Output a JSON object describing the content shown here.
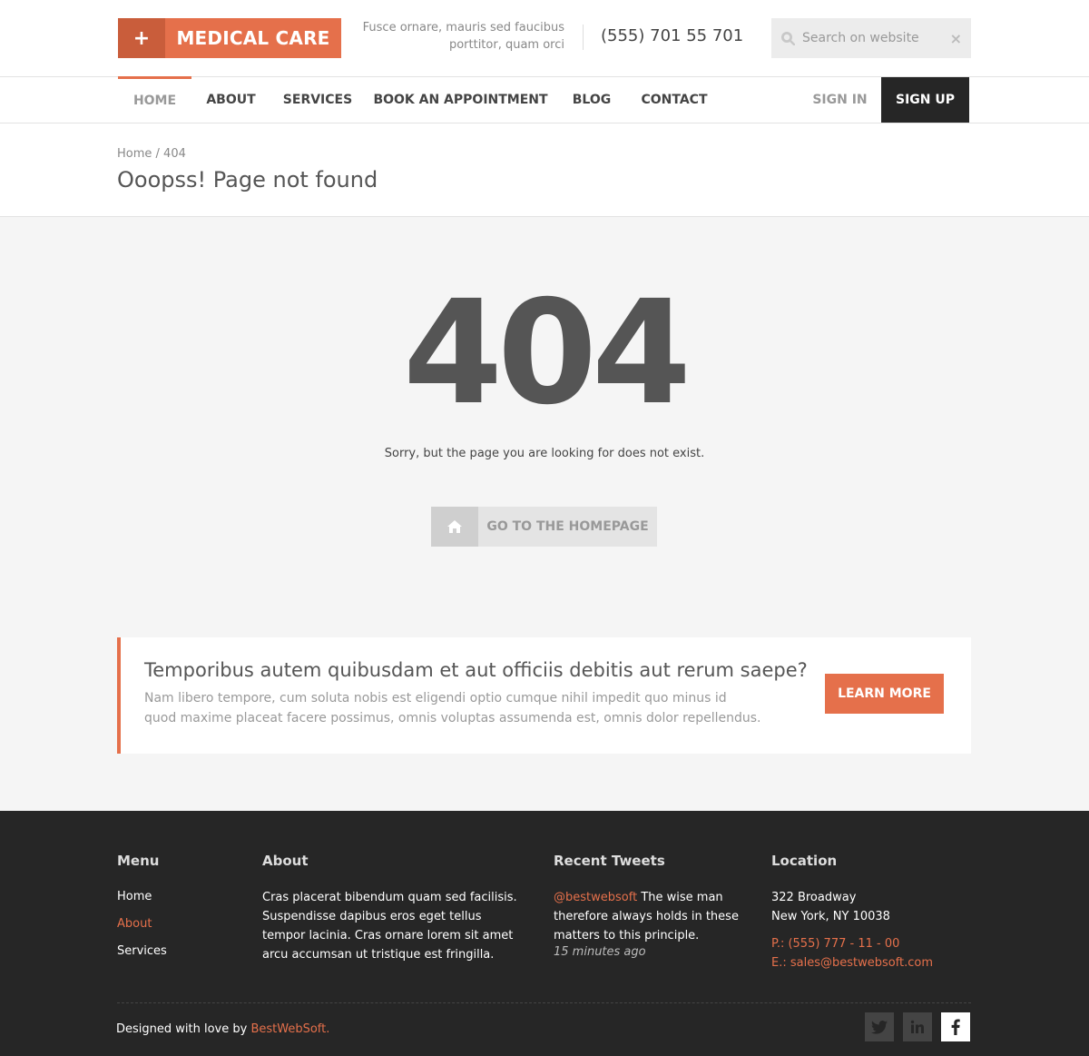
{
  "header": {
    "logo_plus": "+",
    "logo_text": "MEDICAL CARE",
    "tagline_line1": "Fusce ornare, mauris sed faucibus",
    "tagline_line2": "porttitor, quam orci",
    "phone": "(555) 701 55 701",
    "search_placeholder": "Search on website",
    "clear_glyph": "×"
  },
  "nav": {
    "items": [
      {
        "label": "HOME",
        "active": true
      },
      {
        "label": "ABOUT"
      },
      {
        "label": "SERVICES"
      },
      {
        "label": "BOOK AN APPOINTMENT"
      },
      {
        "label": "BLOG"
      },
      {
        "label": "CONTACT"
      }
    ],
    "sign_in": "SIGN IN",
    "sign_up": "SIGN UP"
  },
  "page": {
    "breadcrumb_home": "Home",
    "breadcrumb_sep": " / ",
    "breadcrumb_current": "404",
    "title": "Ooopss! Page not found"
  },
  "error": {
    "code": "404",
    "message": "Sorry, but the page you are looking for does not exist.",
    "button_label": "GO TO THE HOMEPAGE"
  },
  "cta": {
    "title": "Temporibus autem quibusdam et aut officiis debitis aut rerum saepe?",
    "text": "Nam libero tempore, cum soluta nobis est eligendi optio cumque nihil impedit quo minus id quod maxime placeat facere possimus, omnis voluptas assumenda est, omnis dolor repellendus.",
    "button_label": "LEARN MORE"
  },
  "footer": {
    "menu_title": "Menu",
    "menu_items": [
      "Home",
      "About",
      "Services"
    ],
    "about_title": "About",
    "about_text": "Cras placerat bibendum quam sed facilisis. Suspendisse dapibus eros eget tellus tempor lacinia. Cras ornare lorem sit amet arcu accumsan ut tristique est fringilla.",
    "tweets_title": "Recent Tweets",
    "tweet_handle": "@bestwebsoft",
    "tweet_text": " The wise man therefore always holds in these matters to this principle.",
    "tweet_time": "15 minutes ago",
    "location_title": "Location",
    "address_line1": "322 Broadway",
    "address_line2": "New York, NY 10038",
    "phone": "P.: (555) 777 - 11 - 00",
    "email": "E.: sales@bestwebsoft.com",
    "credits_prefix": "Designed with love by ",
    "credits_link": "BestWebSoft.",
    "social": [
      "twitter-icon",
      "linkedin-icon",
      "facebook-icon"
    ]
  },
  "colors": {
    "accent": "#e5704b",
    "dark": "#262626"
  }
}
